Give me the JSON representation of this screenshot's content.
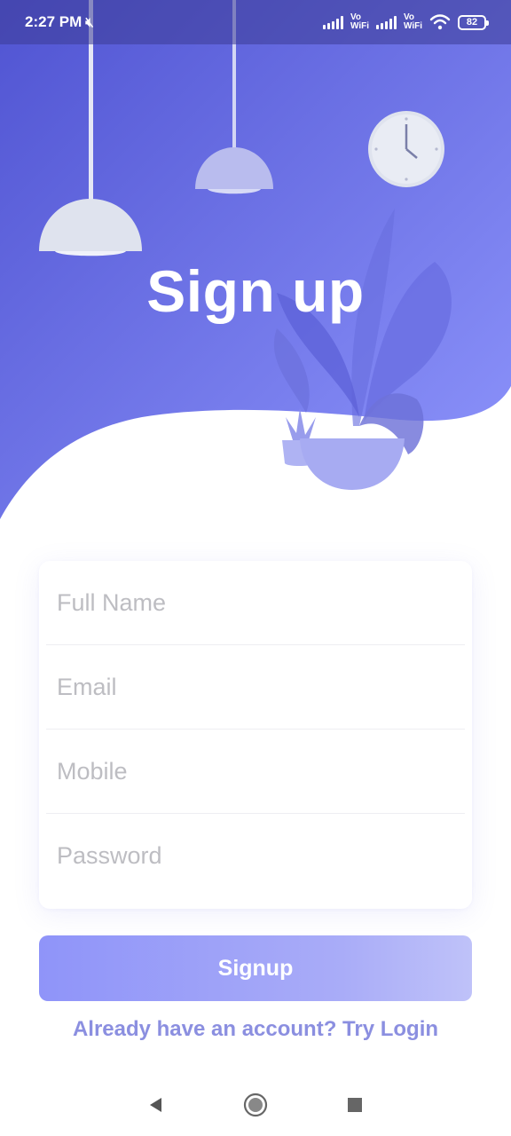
{
  "status_bar": {
    "time": "2:27 PM",
    "vowifi_1": "Vo",
    "vowifi_1b": "WiFi",
    "vowifi_2": "Vo",
    "vowifi_2b": "WiFi",
    "battery": "82"
  },
  "header": {
    "title": "Sign up"
  },
  "form": {
    "full_name": {
      "placeholder": "Full Name",
      "value": ""
    },
    "email": {
      "placeholder": "Email",
      "value": ""
    },
    "mobile": {
      "placeholder": "Mobile",
      "value": ""
    },
    "password": {
      "placeholder": "Password",
      "value": ""
    }
  },
  "signup_label": "Signup",
  "login_prompt": "Already have an account? Try Login",
  "colors": {
    "hero_start": "#5558d6",
    "hero_end": "#8a90fb",
    "accent": "#8b8fe0",
    "button_start": "#8f94f9",
    "button_end": "#bfc2f9"
  },
  "icons": {
    "nav_back": "triangle-left-icon",
    "nav_home": "circle-home-icon",
    "nav_recent": "square-recent-icon"
  }
}
